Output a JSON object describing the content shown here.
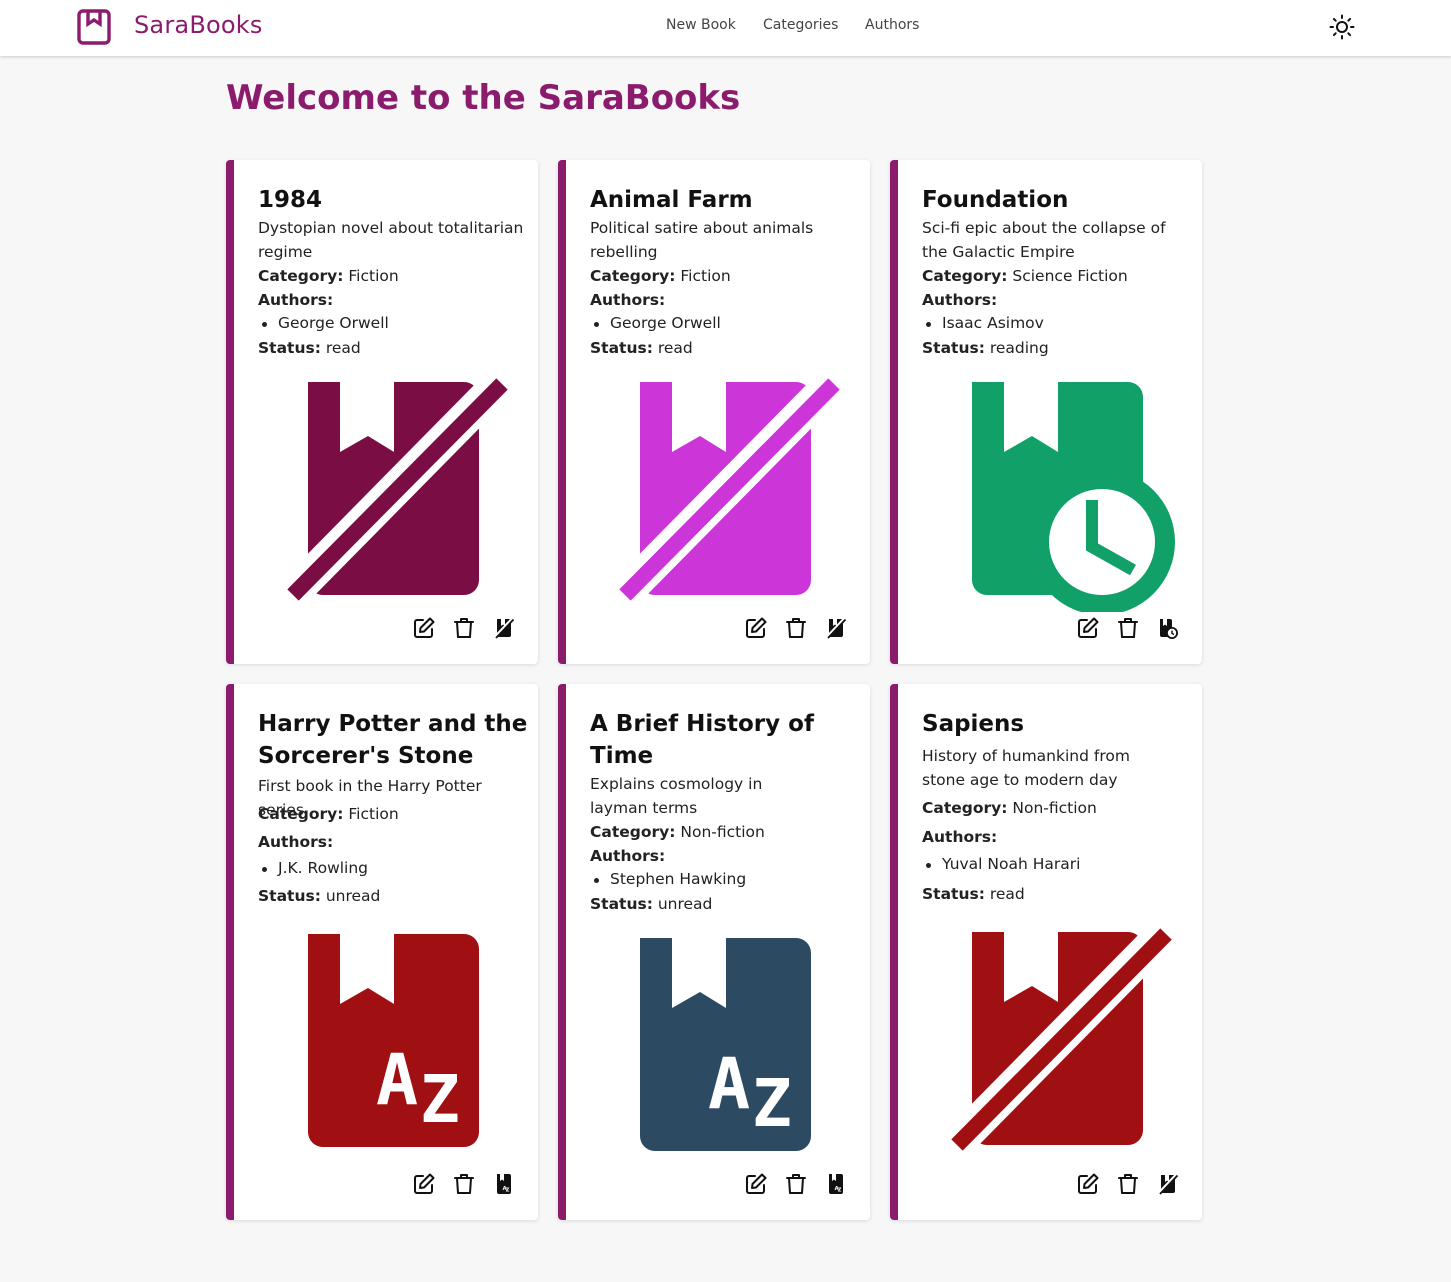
{
  "app": {
    "brand": "SaraBooks",
    "nav": [
      {
        "label": "New Book"
      },
      {
        "label": "Categories"
      },
      {
        "label": "Authors"
      }
    ]
  },
  "page": {
    "title": "Welcome to the SaraBooks"
  },
  "labels": {
    "category": "Category:",
    "authors": "Authors:",
    "status": "Status:"
  },
  "books": [
    {
      "title": "1984",
      "description": "Dystopian novel about totalitarian regime",
      "category": "Fiction",
      "authors": [
        "George Orwell"
      ],
      "status": "read",
      "cover_color": "#7a0d43",
      "cover_icon": "book-read-slash-icon"
    },
    {
      "title": "Animal Farm",
      "description": "Political satire about animals rebelling",
      "category": "Fiction",
      "authors": [
        "George Orwell"
      ],
      "status": "read",
      "cover_color": "#cc36d9",
      "cover_icon": "book-read-slash-icon"
    },
    {
      "title": "Foundation",
      "description": "Sci-fi epic about the collapse of the Galactic Empire",
      "category": "Science Fiction",
      "authors": [
        "Isaac Asimov"
      ],
      "status": "reading",
      "cover_color": "#10a068",
      "cover_icon": "book-clock-icon"
    },
    {
      "title": "Harry Potter and the Sorcerer's Stone",
      "description": "First book in the Harry Potter series",
      "category": "Fiction",
      "authors": [
        "J.K. Rowling"
      ],
      "status": "unread",
      "cover_color": "#a00f12",
      "cover_icon": "book-az-icon"
    },
    {
      "title": "A Brief History of Time",
      "description": "Explains cosmology in layman terms",
      "category": "Non-fiction",
      "authors": [
        "Stephen Hawking"
      ],
      "status": "unread",
      "cover_color": "#2c4a62",
      "cover_icon": "book-az-icon"
    },
    {
      "title": "Sapiens",
      "description": "History of humankind from stone age to modern day",
      "category": "Non-fiction",
      "authors": [
        "Yuval Noah Harari"
      ],
      "status": "read",
      "cover_color": "#a00f12",
      "cover_icon": "book-read-slash-icon"
    }
  ],
  "colors": {
    "brand": "#8b1b6d",
    "background": "#f7f7f7"
  }
}
